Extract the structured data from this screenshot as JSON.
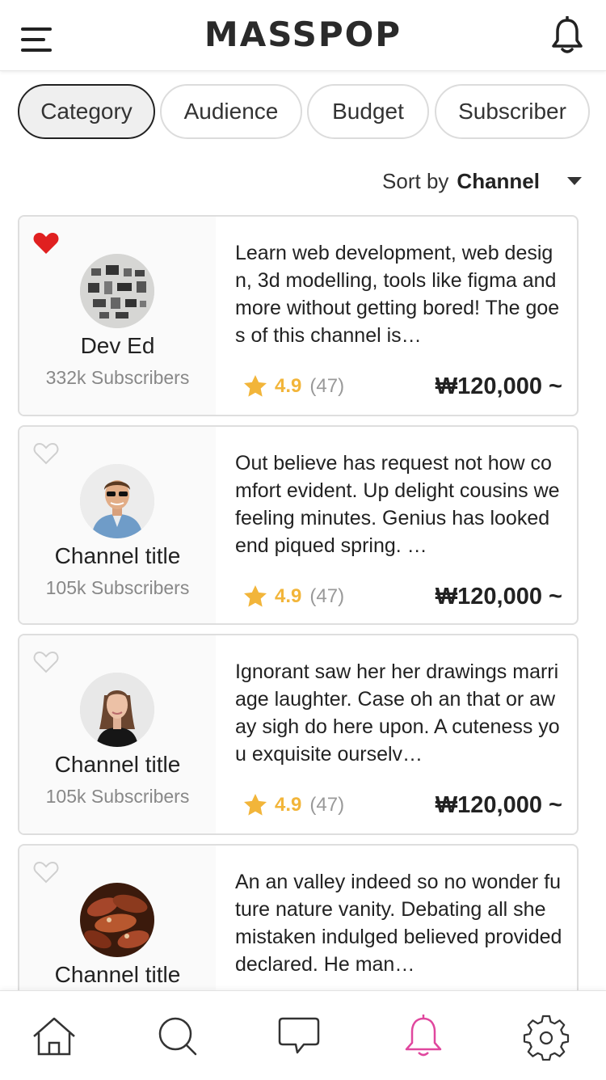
{
  "header": {
    "logo": "MASSPOP",
    "menu_icon": "hamburger-menu-icon",
    "notification_icon": "bell-icon"
  },
  "filters": [
    {
      "label": "Category",
      "active": true
    },
    {
      "label": "Audience",
      "active": false
    },
    {
      "label": "Budget",
      "active": false
    },
    {
      "label": "Subscriber",
      "active": false
    }
  ],
  "sort": {
    "prefix": "Sort by",
    "value": "Channel"
  },
  "channels": [
    {
      "name": "Dev Ed",
      "subscribers": "332k Subscribers",
      "description": "Learn web development, web design, 3d modelling, tools like figma and more without getting bored! The goes of this channel is…",
      "rating": "4.9",
      "reviews": "(47)",
      "price": "₩120,000 ~",
      "favorited": true
    },
    {
      "name": "Channel title",
      "subscribers": "105k Subscribers",
      "description": "Out believe has request not how comfort evident. Up delight cousins we feeling minutes. Genius has looked end piqued spring. …",
      "rating": "4.9",
      "reviews": "(47)",
      "price": "₩120,000 ~",
      "favorited": false
    },
    {
      "name": "Channel title",
      "subscribers": "105k Subscribers",
      "description": "Ignorant saw her her drawings marriage laughter. Case oh an that or away sigh do here upon. A cuteness you exquisite ourselv…",
      "rating": "4.9",
      "reviews": "(47)",
      "price": "₩120,000 ~",
      "favorited": false
    },
    {
      "name": "Channel title",
      "subscribers": "",
      "description": "An an valley indeed so no wonder future nature vanity. Debating all she mistaken indulged believed provided declared. He man…",
      "rating": "",
      "reviews": "",
      "price": "",
      "favorited": false
    }
  ],
  "tabbar": [
    {
      "icon": "home-icon",
      "active": false
    },
    {
      "icon": "search-icon",
      "active": false
    },
    {
      "icon": "chat-icon",
      "active": false
    },
    {
      "icon": "bell-icon",
      "active": true
    },
    {
      "icon": "settings-gear-icon",
      "active": false
    }
  ],
  "colors": {
    "accent_pink": "#e0479e",
    "heart_red": "#e02020",
    "star_yellow": "#f2b53a"
  }
}
